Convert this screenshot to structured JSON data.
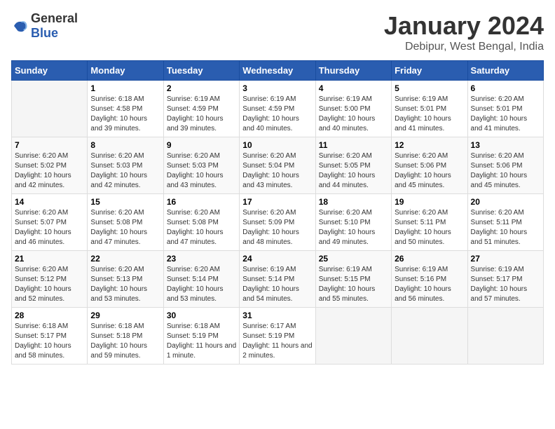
{
  "logo": {
    "text_general": "General",
    "text_blue": "Blue"
  },
  "header": {
    "month_year": "January 2024",
    "location": "Debipur, West Bengal, India"
  },
  "days_of_week": [
    "Sunday",
    "Monday",
    "Tuesday",
    "Wednesday",
    "Thursday",
    "Friday",
    "Saturday"
  ],
  "weeks": [
    [
      {
        "day": "",
        "sunrise": "",
        "sunset": "",
        "daylight": ""
      },
      {
        "day": "1",
        "sunrise": "Sunrise: 6:18 AM",
        "sunset": "Sunset: 4:58 PM",
        "daylight": "Daylight: 10 hours and 39 minutes."
      },
      {
        "day": "2",
        "sunrise": "Sunrise: 6:19 AM",
        "sunset": "Sunset: 4:59 PM",
        "daylight": "Daylight: 10 hours and 39 minutes."
      },
      {
        "day": "3",
        "sunrise": "Sunrise: 6:19 AM",
        "sunset": "Sunset: 4:59 PM",
        "daylight": "Daylight: 10 hours and 40 minutes."
      },
      {
        "day": "4",
        "sunrise": "Sunrise: 6:19 AM",
        "sunset": "Sunset: 5:00 PM",
        "daylight": "Daylight: 10 hours and 40 minutes."
      },
      {
        "day": "5",
        "sunrise": "Sunrise: 6:19 AM",
        "sunset": "Sunset: 5:01 PM",
        "daylight": "Daylight: 10 hours and 41 minutes."
      },
      {
        "day": "6",
        "sunrise": "Sunrise: 6:20 AM",
        "sunset": "Sunset: 5:01 PM",
        "daylight": "Daylight: 10 hours and 41 minutes."
      }
    ],
    [
      {
        "day": "7",
        "sunrise": "Sunrise: 6:20 AM",
        "sunset": "Sunset: 5:02 PM",
        "daylight": "Daylight: 10 hours and 42 minutes."
      },
      {
        "day": "8",
        "sunrise": "Sunrise: 6:20 AM",
        "sunset": "Sunset: 5:03 PM",
        "daylight": "Daylight: 10 hours and 42 minutes."
      },
      {
        "day": "9",
        "sunrise": "Sunrise: 6:20 AM",
        "sunset": "Sunset: 5:03 PM",
        "daylight": "Daylight: 10 hours and 43 minutes."
      },
      {
        "day": "10",
        "sunrise": "Sunrise: 6:20 AM",
        "sunset": "Sunset: 5:04 PM",
        "daylight": "Daylight: 10 hours and 43 minutes."
      },
      {
        "day": "11",
        "sunrise": "Sunrise: 6:20 AM",
        "sunset": "Sunset: 5:05 PM",
        "daylight": "Daylight: 10 hours and 44 minutes."
      },
      {
        "day": "12",
        "sunrise": "Sunrise: 6:20 AM",
        "sunset": "Sunset: 5:06 PM",
        "daylight": "Daylight: 10 hours and 45 minutes."
      },
      {
        "day": "13",
        "sunrise": "Sunrise: 6:20 AM",
        "sunset": "Sunset: 5:06 PM",
        "daylight": "Daylight: 10 hours and 45 minutes."
      }
    ],
    [
      {
        "day": "14",
        "sunrise": "Sunrise: 6:20 AM",
        "sunset": "Sunset: 5:07 PM",
        "daylight": "Daylight: 10 hours and 46 minutes."
      },
      {
        "day": "15",
        "sunrise": "Sunrise: 6:20 AM",
        "sunset": "Sunset: 5:08 PM",
        "daylight": "Daylight: 10 hours and 47 minutes."
      },
      {
        "day": "16",
        "sunrise": "Sunrise: 6:20 AM",
        "sunset": "Sunset: 5:08 PM",
        "daylight": "Daylight: 10 hours and 47 minutes."
      },
      {
        "day": "17",
        "sunrise": "Sunrise: 6:20 AM",
        "sunset": "Sunset: 5:09 PM",
        "daylight": "Daylight: 10 hours and 48 minutes."
      },
      {
        "day": "18",
        "sunrise": "Sunrise: 6:20 AM",
        "sunset": "Sunset: 5:10 PM",
        "daylight": "Daylight: 10 hours and 49 minutes."
      },
      {
        "day": "19",
        "sunrise": "Sunrise: 6:20 AM",
        "sunset": "Sunset: 5:11 PM",
        "daylight": "Daylight: 10 hours and 50 minutes."
      },
      {
        "day": "20",
        "sunrise": "Sunrise: 6:20 AM",
        "sunset": "Sunset: 5:11 PM",
        "daylight": "Daylight: 10 hours and 51 minutes."
      }
    ],
    [
      {
        "day": "21",
        "sunrise": "Sunrise: 6:20 AM",
        "sunset": "Sunset: 5:12 PM",
        "daylight": "Daylight: 10 hours and 52 minutes."
      },
      {
        "day": "22",
        "sunrise": "Sunrise: 6:20 AM",
        "sunset": "Sunset: 5:13 PM",
        "daylight": "Daylight: 10 hours and 53 minutes."
      },
      {
        "day": "23",
        "sunrise": "Sunrise: 6:20 AM",
        "sunset": "Sunset: 5:14 PM",
        "daylight": "Daylight: 10 hours and 53 minutes."
      },
      {
        "day": "24",
        "sunrise": "Sunrise: 6:19 AM",
        "sunset": "Sunset: 5:14 PM",
        "daylight": "Daylight: 10 hours and 54 minutes."
      },
      {
        "day": "25",
        "sunrise": "Sunrise: 6:19 AM",
        "sunset": "Sunset: 5:15 PM",
        "daylight": "Daylight: 10 hours and 55 minutes."
      },
      {
        "day": "26",
        "sunrise": "Sunrise: 6:19 AM",
        "sunset": "Sunset: 5:16 PM",
        "daylight": "Daylight: 10 hours and 56 minutes."
      },
      {
        "day": "27",
        "sunrise": "Sunrise: 6:19 AM",
        "sunset": "Sunset: 5:17 PM",
        "daylight": "Daylight: 10 hours and 57 minutes."
      }
    ],
    [
      {
        "day": "28",
        "sunrise": "Sunrise: 6:18 AM",
        "sunset": "Sunset: 5:17 PM",
        "daylight": "Daylight: 10 hours and 58 minutes."
      },
      {
        "day": "29",
        "sunrise": "Sunrise: 6:18 AM",
        "sunset": "Sunset: 5:18 PM",
        "daylight": "Daylight: 10 hours and 59 minutes."
      },
      {
        "day": "30",
        "sunrise": "Sunrise: 6:18 AM",
        "sunset": "Sunset: 5:19 PM",
        "daylight": "Daylight: 11 hours and 1 minute."
      },
      {
        "day": "31",
        "sunrise": "Sunrise: 6:17 AM",
        "sunset": "Sunset: 5:19 PM",
        "daylight": "Daylight: 11 hours and 2 minutes."
      },
      {
        "day": "",
        "sunrise": "",
        "sunset": "",
        "daylight": ""
      },
      {
        "day": "",
        "sunrise": "",
        "sunset": "",
        "daylight": ""
      },
      {
        "day": "",
        "sunrise": "",
        "sunset": "",
        "daylight": ""
      }
    ]
  ]
}
